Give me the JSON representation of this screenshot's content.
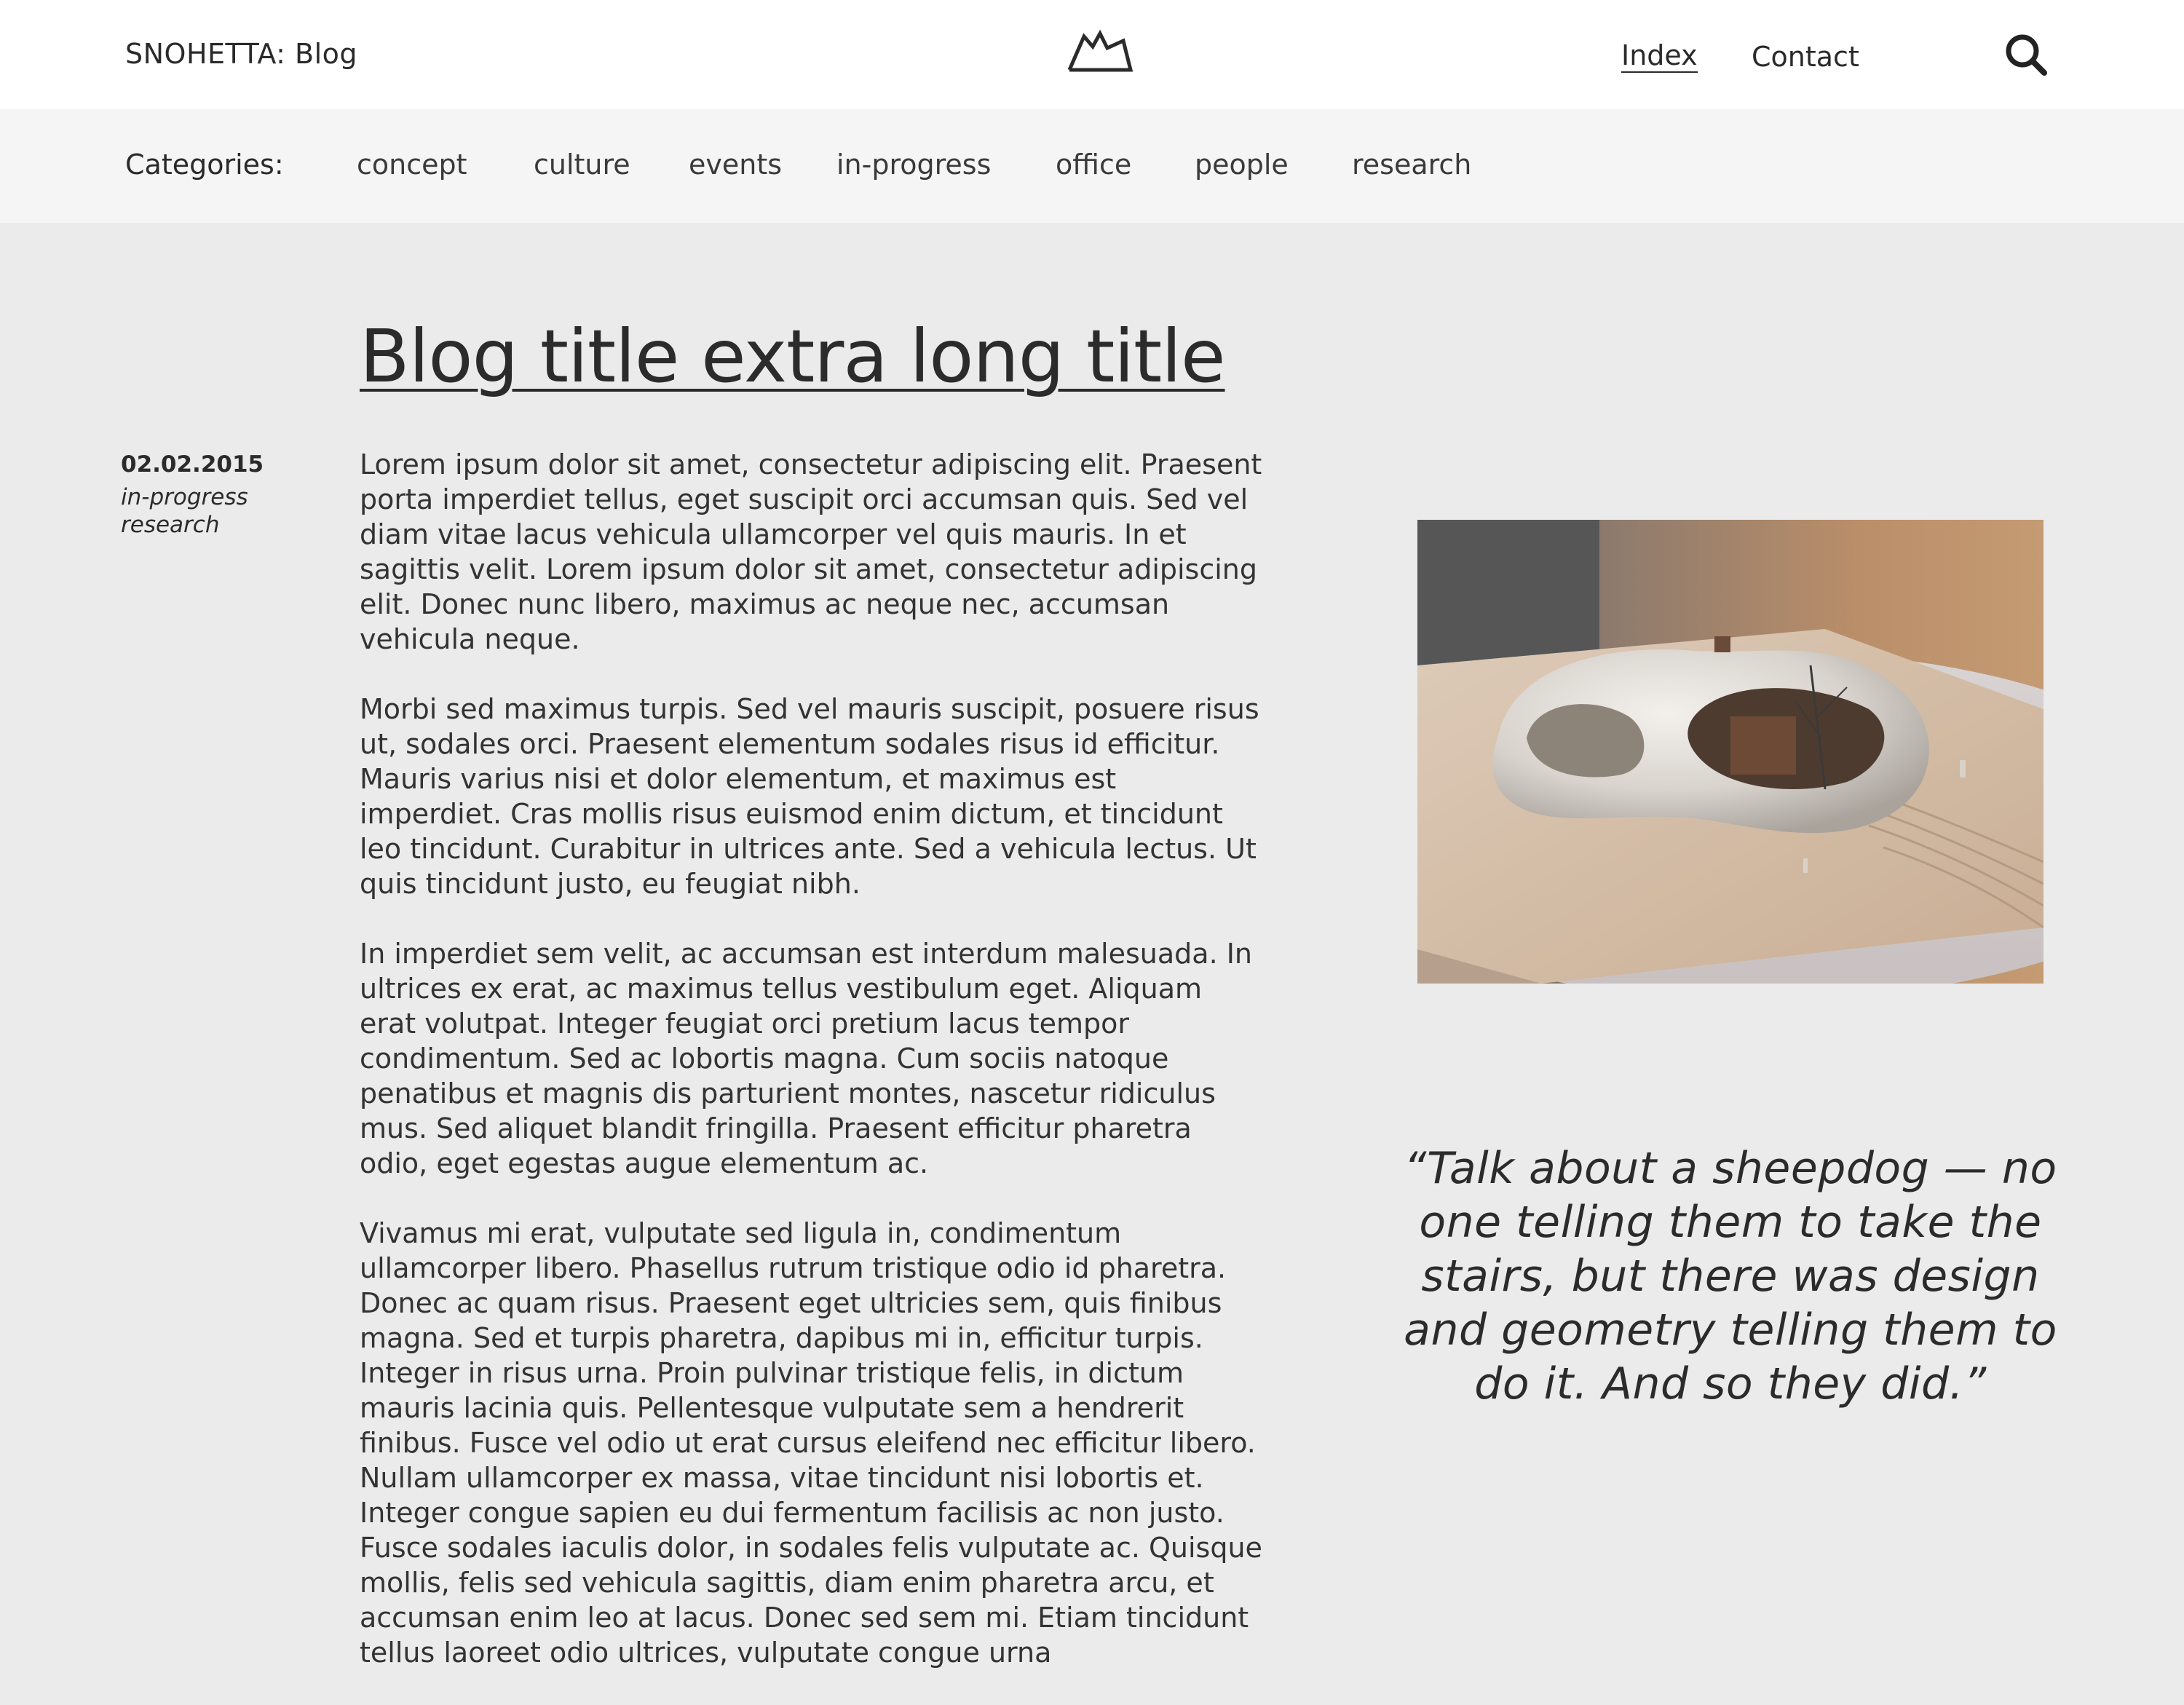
{
  "header": {
    "brand": "SNOHETTA: Blog",
    "logo_icon": "mountain-logo-icon",
    "nav": [
      {
        "label": "Index",
        "active": true
      },
      {
        "label": "Contact",
        "active": false
      }
    ],
    "search_icon": "search-icon"
  },
  "categories": {
    "label": "Categories:",
    "items": [
      "concept",
      "culture",
      "events",
      "in-progress",
      "office",
      "people",
      "research"
    ]
  },
  "post": {
    "title": "Blog title extra long title",
    "date": "02.02.2015",
    "tags": [
      "in-progress",
      "research"
    ],
    "paragraphs": [
      "Lorem ipsum dolor sit amet, consectetur adipiscing elit. Praesent porta imperdiet tellus, eget suscipit orci accumsan quis. Sed vel diam vitae lacus vehicula ullamcorper vel quis mauris. In et sagittis velit. Lorem ipsum dolor sit amet, consectetur adipiscing elit. Donec nunc libero, maximus ac neque nec, accumsan vehicula neque.",
      "Morbi sed maximus turpis. Sed vel mauris suscipit, posuere risus ut, sodales orci. Praesent elementum sodales risus id efficitur. Mauris varius nisi et dolor elementum, et maximus est imperdiet. Cras mollis risus euismod enim dictum, et tincidunt leo tincidunt. Curabitur in ultrices ante. Sed a vehicula lectus. Ut quis tincidunt justo, eu feugiat nibh.",
      "In imperdiet sem velit, ac accumsan est interdum malesuada. In ultrices ex erat, ac maximus tellus vestibulum eget. Aliquam erat volutpat. Integer feugiat orci pretium lacus tempor condimentum. Sed ac lobortis magna. Cum sociis natoque penatibus et magnis dis parturient montes, nascetur ridiculus mus. Sed aliquet blandit fringilla. Praesent efficitur pharetra odio, eget egestas augue elementum ac.",
      "Vivamus mi erat, vulputate sed ligula in, condimentum ullamcorper libero. Phasellus rutrum tristique odio id pharetra. Donec ac quam risus. Praesent eget ultricies sem, quis finibus magna. Sed et turpis pharetra, dapibus mi in, efficitur turpis. Integer in risus urna. Proin pulvinar tristique felis, in dictum mauris lacinia quis. Pellentesque vulputate sem a hendrerit finibus. Fusce vel odio ut erat cursus eleifend nec efficitur libero. Nullam ullamcorper ex massa, vitae tincidunt nisi lobortis et. Integer congue sapien eu dui fermentum facilisis ac non justo. Fusce sodales iaculis dolor, in sodales felis vulputate ac. Quisque mollis, felis sed vehicula sagittis, diam enim pharetra arcu, et accumsan enim leo at lacus. Donec sed sem mi. Etiam tincidunt tellus laoreet odio ultrices, vulputate congue urna"
    ],
    "quote": "“Talk about a sheepdog — no one telling them to take the stairs, but there was design and geometry telling them to do it. And so they did.”"
  },
  "colors": {
    "page_background": "#ebebeb",
    "header_background": "#ffffff",
    "category_bar_background": "#f5f5f5",
    "text": "#2b2b2b"
  }
}
